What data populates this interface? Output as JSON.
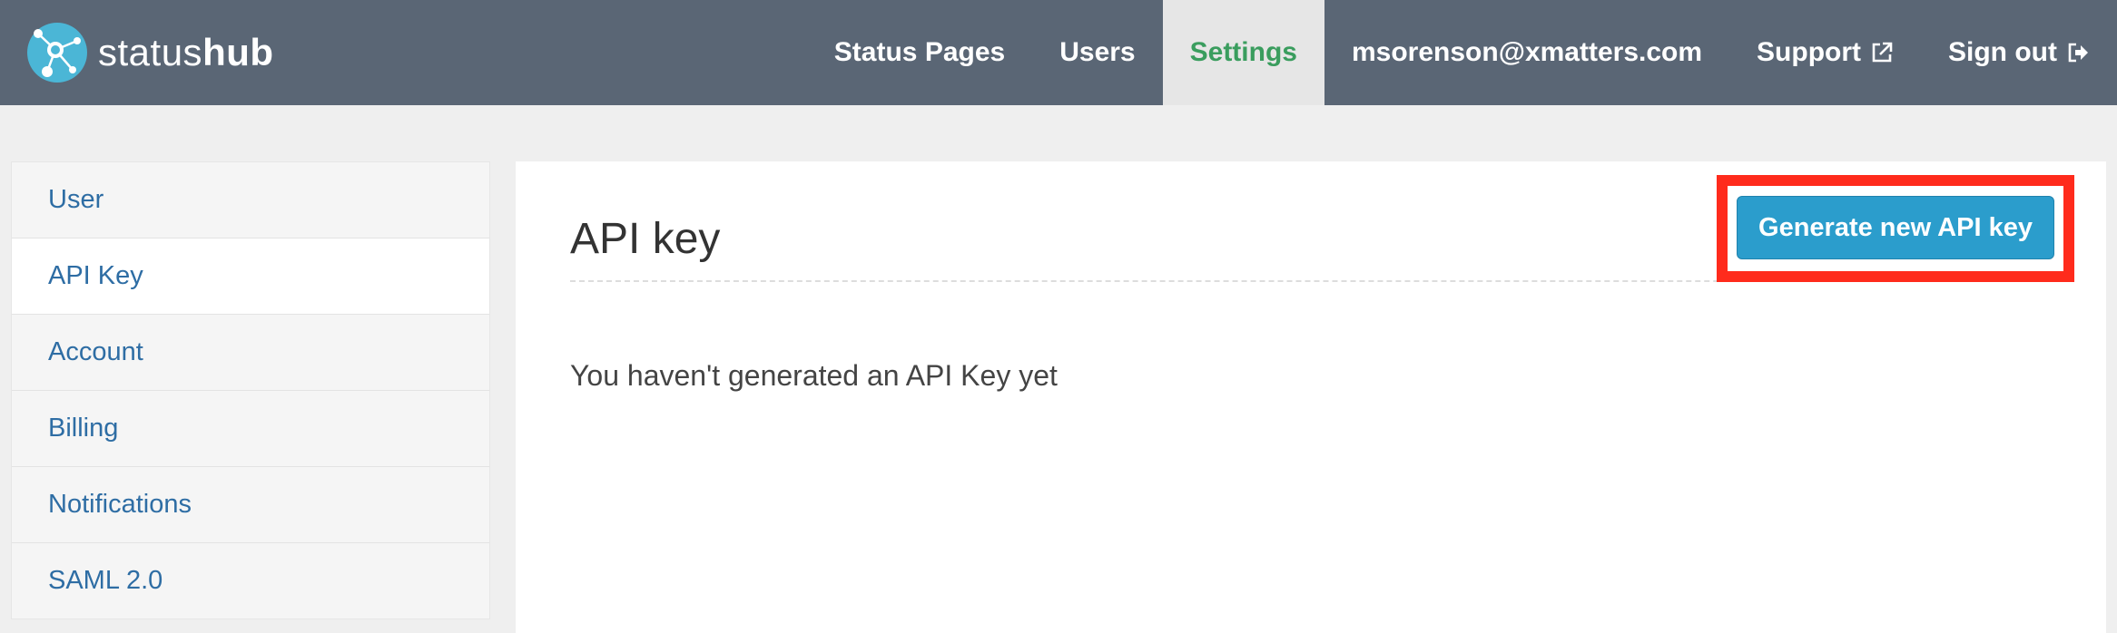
{
  "brand": {
    "name_light": "status",
    "name_bold": "hub",
    "logo_icon": "network-nodes-icon"
  },
  "nav": {
    "items": [
      {
        "label": "Status Pages",
        "active": false
      },
      {
        "label": "Users",
        "active": false
      },
      {
        "label": "Settings",
        "active": true
      },
      {
        "label": "msorenson@xmatters.com",
        "active": false
      },
      {
        "label": "Support",
        "active": false,
        "icon": "external-link-icon"
      },
      {
        "label": "Sign out",
        "active": false,
        "icon": "sign-out-icon"
      }
    ]
  },
  "sidebar": {
    "items": [
      {
        "label": "User",
        "active": false
      },
      {
        "label": "API Key",
        "active": true
      },
      {
        "label": "Account",
        "active": false
      },
      {
        "label": "Billing",
        "active": false
      },
      {
        "label": "Notifications",
        "active": false
      },
      {
        "label": "SAML 2.0",
        "active": false
      }
    ]
  },
  "main": {
    "title": "API key",
    "generate_button_label": "Generate new API key",
    "empty_message": "You haven't generated an API Key yet"
  },
  "colors": {
    "topbar": "#5a6675",
    "active_nav_text": "#3a9d5e",
    "link": "#2e6da4",
    "button": "#2b9dcc",
    "highlight": "#ff2b1c"
  }
}
